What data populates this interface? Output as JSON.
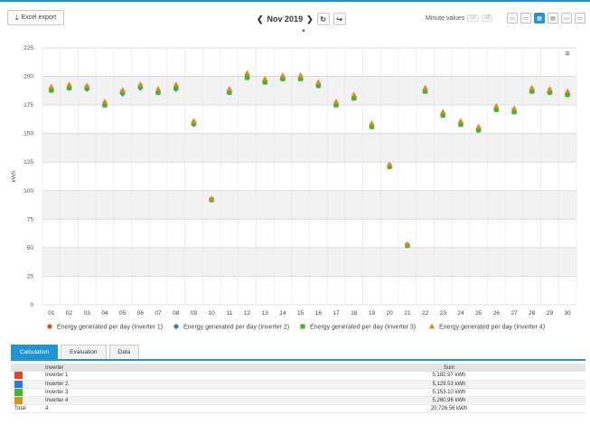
{
  "toolbar": {
    "excel_label": "Excel export",
    "period": "Nov 2019",
    "minute_values_label": "Minute values",
    "toggle_on": "on",
    "toggle_off": "off"
  },
  "colors": {
    "accent": "#1f95d3",
    "inverter1": "#e04a1f",
    "inverter2": "#2b7bd1",
    "inverter3": "#3fb72a",
    "inverter4": "#d4a23a"
  },
  "chart_data": {
    "type": "scatter",
    "categories": [
      "01",
      "02",
      "03",
      "04",
      "05",
      "06",
      "07",
      "08",
      "09",
      "10",
      "11",
      "12",
      "13",
      "14",
      "15",
      "16",
      "17",
      "18",
      "19",
      "20",
      "21",
      "22",
      "23",
      "24",
      "25",
      "26",
      "27",
      "28",
      "29",
      "30"
    ],
    "ylabel": "kWh",
    "ylim": [
      0,
      225
    ],
    "yticks": [
      0,
      25,
      50,
      75,
      100,
      125,
      150,
      175,
      200,
      225
    ],
    "grid": true,
    "legend_position": "bottom",
    "series": [
      {
        "name": "Energy generated per day (Inverter 1)",
        "marker": "circle",
        "color": "#e04a1f",
        "values": [
          189,
          191,
          190,
          176,
          186,
          191,
          187,
          190,
          159,
          92,
          187,
          200,
          196,
          198,
          199,
          193,
          176,
          182,
          157,
          122,
          52,
          188,
          167,
          159,
          154,
          172,
          170,
          188,
          187,
          185
        ]
      },
      {
        "name": "Energy generated per day (Inverter 2)",
        "marker": "diamond",
        "color": "#2b7bd1",
        "values": [
          188,
          190,
          189,
          175,
          185,
          190,
          186,
          189,
          158,
          92,
          186,
          199,
          195,
          198,
          198,
          192,
          175,
          181,
          156,
          121,
          52,
          187,
          166,
          158,
          153,
          171,
          169,
          187,
          186,
          184
        ]
      },
      {
        "name": "Energy generated per day (Inverter 3)",
        "marker": "square",
        "color": "#3fb72a",
        "values": [
          188,
          190,
          190,
          175,
          186,
          191,
          186,
          190,
          159,
          92,
          186,
          199,
          195,
          198,
          198,
          192,
          175,
          181,
          156,
          121,
          52,
          187,
          166,
          158,
          153,
          171,
          169,
          187,
          186,
          184
        ]
      },
      {
        "name": "Energy generated per day (Inverter 4)",
        "marker": "triangle",
        "color": "#e08a1a",
        "values": [
          191,
          193,
          192,
          178,
          188,
          193,
          189,
          193,
          161,
          93,
          189,
          203,
          198,
          201,
          201,
          195,
          178,
          184,
          159,
          123,
          53,
          190,
          169,
          161,
          156,
          174,
          172,
          190,
          189,
          187
        ]
      }
    ]
  },
  "tabs": [
    {
      "label": "Calculation"
    },
    {
      "label": "Evaluation"
    },
    {
      "label": "Data"
    }
  ],
  "table": {
    "headers": {
      "inverter": "Inverter",
      "sum": "Sum"
    },
    "rows": [
      {
        "name": "Inverter 1",
        "sum": "5,182.97 kWh",
        "color": "#e04a1f"
      },
      {
        "name": "Inverter 2",
        "sum": "5,129.53 kWh",
        "color": "#2b7bd1"
      },
      {
        "name": "Inverter 3",
        "sum": "5,153.10 kWh",
        "color": "#3fb72a"
      },
      {
        "name": "Inverter 4",
        "sum": "5,260.96 kWh",
        "color": "#c9981e"
      }
    ],
    "total": {
      "label": "Total",
      "count": "4",
      "sum": "20,726.56 kWh"
    }
  }
}
